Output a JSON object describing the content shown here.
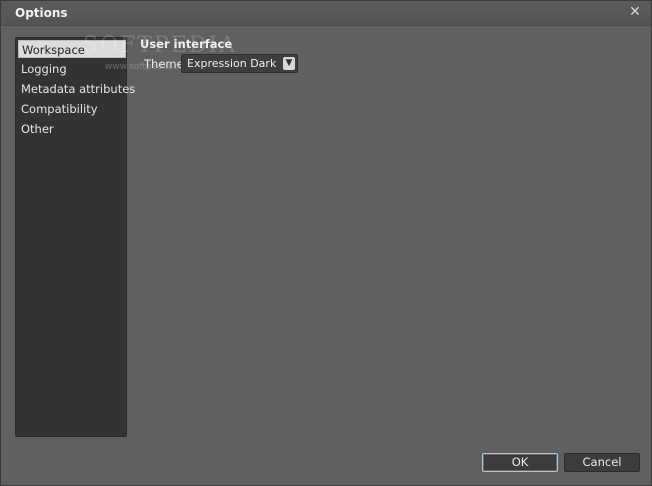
{
  "window": {
    "title": "Options",
    "close_glyph": "✕"
  },
  "sidebar": {
    "items": [
      {
        "label": "Workspace",
        "selected": true
      },
      {
        "label": "Logging",
        "selected": false
      },
      {
        "label": "Metadata attributes",
        "selected": false
      },
      {
        "label": "Compatibility",
        "selected": false
      },
      {
        "label": "Other",
        "selected": false
      }
    ]
  },
  "watermark": {
    "text": "SOFTPEDIA",
    "url": "www.softpedia.com"
  },
  "content": {
    "section_header": "User interface",
    "theme_label": "Theme",
    "theme_value": "Expression Dark",
    "dropdown_icon": "chevron-down-icon"
  },
  "footer": {
    "ok_label": "OK",
    "cancel_label": "Cancel"
  }
}
